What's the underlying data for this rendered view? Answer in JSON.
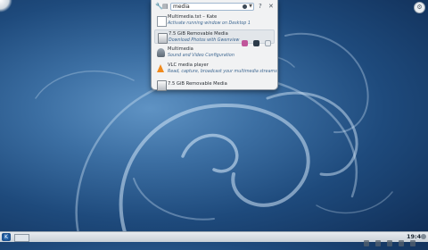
{
  "krunner": {
    "search_value": "media",
    "results": [
      {
        "title": "Multimedia.txt – Kate",
        "subtitle": "Activate running window on Desktop 1",
        "icon": "text-document-icon"
      },
      {
        "title": "7.5 GiB Removable Media",
        "subtitle": "Download Photos with Gwenview",
        "icon": "removable-drive-icon",
        "selected": true
      },
      {
        "title": "Multimedia",
        "subtitle": "Sound and Video Configuration",
        "icon": "multimedia-icon"
      },
      {
        "title": "VLC media player",
        "subtitle": "Read, capture, broadcast your multimedia streams",
        "icon": "vlc-icon"
      },
      {
        "title": "7.5 GiB Removable Media",
        "subtitle": "",
        "icon": "removable-drive-icon"
      }
    ],
    "help_label": "?",
    "close_label": "✕"
  },
  "panel": {
    "clock": "19:49"
  },
  "colors": {
    "accent": "#3e6791",
    "wallpaper_dark": "#0f2c54",
    "wallpaper_light": "#5f93c4"
  }
}
